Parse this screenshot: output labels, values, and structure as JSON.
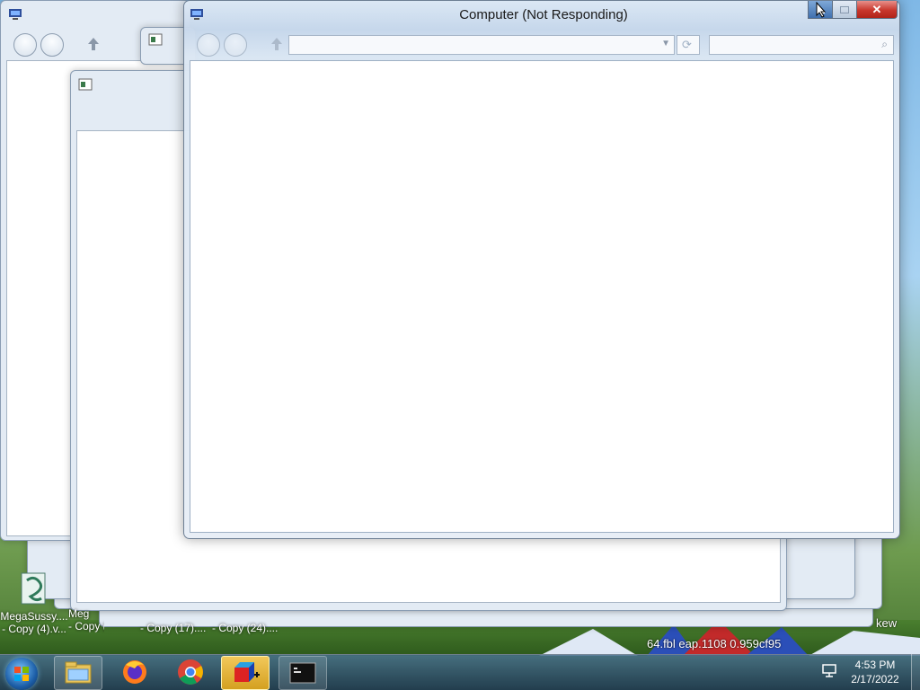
{
  "main_window": {
    "title": "Computer (Not Responding)"
  },
  "desktop_icons": [
    {
      "label": "MegaSussy....\n- Copy (4).v..."
    },
    {
      "label": "Meg\n- Copy (10)...."
    },
    {
      "label": "- Copy (17)...."
    },
    {
      "label": "- Copy (24)...."
    }
  ],
  "background_text": {
    "partial_filename": "64.fbl  eap.1108  0.959cf95",
    "right_edge": "kew"
  },
  "taskbar": {
    "items": [
      "start-button",
      "windows-explorer",
      "firefox",
      "chrome",
      "app-cube",
      "command-prompt"
    ],
    "clock_time": "4:53 PM",
    "clock_date": "2/17/2022"
  },
  "colors": {
    "close_button": "#c8372d",
    "taskbar_active": "#d4a020"
  }
}
